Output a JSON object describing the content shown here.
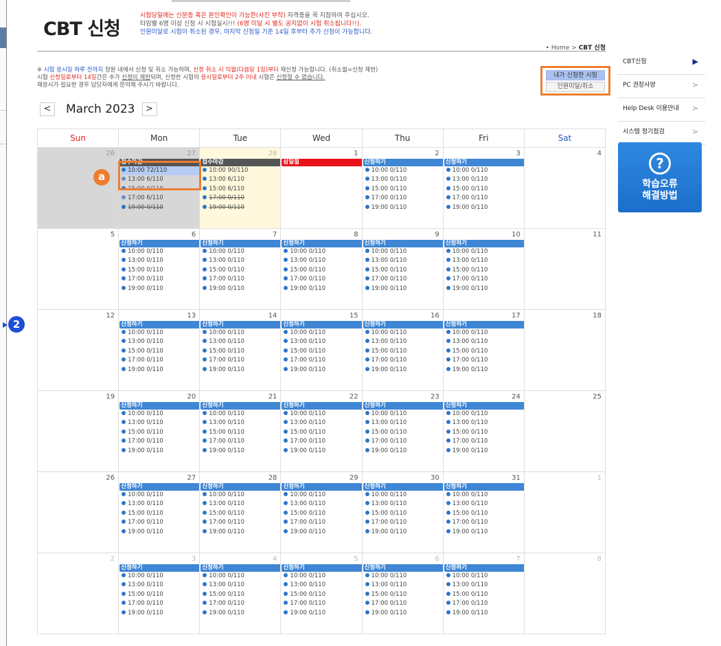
{
  "header": {
    "title": "CBT 신청",
    "notice": [
      {
        "parts": [
          {
            "t": "시험당일",
            "c": "red"
          },
          {
            "t": "에는 신분증 혹은 ",
            "c": "red"
          },
          {
            "t": "본인확인이 가능한(사진 부착)",
            "c": "red"
          },
          {
            "t": " 자격증을 꼭 지참하여 주십시오.",
            "c": "gray"
          }
        ]
      },
      {
        "parts": [
          {
            "t": "타임별 6명 이상 신청 시 시험실시!!! ",
            "c": "gray"
          },
          {
            "t": "(6명 미달 시 별도 공지없이 시험 취소됩니다!!).",
            "c": "red"
          }
        ]
      },
      {
        "parts": [
          {
            "t": "인원미달로 시험이 취소된 경우, 마지막 신청일 기준 14일 후부터 추가 신청이 가능합니다.",
            "c": "blue"
          }
        ]
      }
    ],
    "breadcrumb_home": "Home",
    "breadcrumb_sep": ">",
    "breadcrumb_current": "CBT 신청"
  },
  "info": {
    "line1": [
      {
        "t": "※ ",
        "c": ""
      },
      {
        "t": "시험 응시일 하루 전까지",
        "c": "blue"
      },
      {
        "t": " 정원 내에서 신청 및 취소 가능하며, ",
        "c": ""
      },
      {
        "t": "신청 취소 시 익월(다음달 1일)부터",
        "c": "red"
      },
      {
        "t": " 재신청 가능합니다. (취소월=신청 제한)",
        "c": ""
      }
    ],
    "line2": [
      {
        "t": "   시험 ",
        "c": ""
      },
      {
        "t": "신청일로부터 14일",
        "c": "red"
      },
      {
        "t": "간은 추가 ",
        "c": ""
      },
      {
        "t": "신청이 제한",
        "c": "u"
      },
      {
        "t": "되며, 신청한 시험의 ",
        "c": ""
      },
      {
        "t": "응시일로부터 2주 이내",
        "c": "red"
      },
      {
        "t": " 시험은 ",
        "c": ""
      },
      {
        "t": "신청할 수 없습니다.",
        "c": "u"
      }
    ],
    "line3": [
      {
        "t": "   재응시가 필요한 경우 담당자에게 문의해 주시기 바랍니다.",
        "c": ""
      }
    ]
  },
  "mybox": {
    "my_exams": "내가 신청한 시험",
    "cancelled": "인원미달/취소"
  },
  "calendar": {
    "month_label": "March 2023",
    "prev": "<",
    "next": ">",
    "weekdays": [
      "Sun",
      "Mon",
      "Tue",
      "Wed",
      "Thu",
      "Fri",
      "Sat"
    ],
    "weeks": [
      [
        {
          "day": "26",
          "state": "past",
          "other": true
        },
        {
          "day": "27",
          "state": "past",
          "other": true,
          "bar": "접수마감",
          "bartype": "closed",
          "slots": [
            {
              "t": "10:00 72/110",
              "s": "hl"
            },
            {
              "t": "13:00 6/110",
              "s": "gray"
            },
            {
              "t": "15:00 0/110",
              "s": "strike"
            },
            {
              "t": "17:00 6/110",
              "s": "gray"
            },
            {
              "t": "19:00 0/110",
              "s": "strike"
            }
          ]
        },
        {
          "day": "28",
          "state": "today",
          "other": true,
          "bar": "접수마감",
          "bartype": "closed",
          "slots": [
            {
              "t": "10:00 90/110",
              "s": ""
            },
            {
              "t": "13:00 6/110",
              "s": ""
            },
            {
              "t": "15:00 6/110",
              "s": ""
            },
            {
              "t": "17:00 0/110",
              "s": "strike"
            },
            {
              "t": "19:00 0/110",
              "s": "strike"
            }
          ]
        },
        {
          "day": "1",
          "bar": "삼일절",
          "bartype": "holiday"
        },
        {
          "day": "2",
          "bar": "신청하기",
          "bartype": "apply",
          "slots": "std"
        },
        {
          "day": "3",
          "bar": "신청하기",
          "bartype": "apply",
          "slots": "std"
        },
        {
          "day": "4"
        }
      ],
      [
        {
          "day": "5"
        },
        {
          "day": "6",
          "bar": "신청하기",
          "bartype": "apply",
          "slots": "std"
        },
        {
          "day": "7",
          "bar": "신청하기",
          "bartype": "apply",
          "slots": "std"
        },
        {
          "day": "8",
          "bar": "신청하기",
          "bartype": "apply",
          "slots": "std"
        },
        {
          "day": "9",
          "bar": "신청하기",
          "bartype": "apply",
          "slots": "std"
        },
        {
          "day": "10",
          "bar": "신청하기",
          "bartype": "apply",
          "slots": "std"
        },
        {
          "day": "11"
        }
      ],
      [
        {
          "day": "12"
        },
        {
          "day": "13",
          "bar": "신청하기",
          "bartype": "apply",
          "slots": "std"
        },
        {
          "day": "14",
          "bar": "신청하기",
          "bartype": "apply",
          "slots": "std"
        },
        {
          "day": "15",
          "bar": "신청하기",
          "bartype": "apply",
          "slots": "std"
        },
        {
          "day": "16",
          "bar": "신청하기",
          "bartype": "apply",
          "slots": "std"
        },
        {
          "day": "17",
          "bar": "신청하기",
          "bartype": "apply",
          "slots": "std"
        },
        {
          "day": "18"
        }
      ],
      [
        {
          "day": "19"
        },
        {
          "day": "20",
          "bar": "신청하기",
          "bartype": "apply",
          "slots": "std"
        },
        {
          "day": "21",
          "bar": "신청하기",
          "bartype": "apply",
          "slots": "std"
        },
        {
          "day": "22",
          "bar": "신청하기",
          "bartype": "apply",
          "slots": "std"
        },
        {
          "day": "23",
          "bar": "신청하기",
          "bartype": "apply",
          "slots": "std"
        },
        {
          "day": "24",
          "bar": "신청하기",
          "bartype": "apply",
          "slots": "std"
        },
        {
          "day": "25"
        }
      ],
      [
        {
          "day": "26"
        },
        {
          "day": "27",
          "bar": "신청하기",
          "bartype": "apply",
          "slots": "std"
        },
        {
          "day": "28",
          "bar": "신청하기",
          "bartype": "apply",
          "slots": "std"
        },
        {
          "day": "29",
          "bar": "신청하기",
          "bartype": "apply",
          "slots": "std"
        },
        {
          "day": "30",
          "bar": "신청하기",
          "bartype": "apply",
          "slots": "std"
        },
        {
          "day": "31",
          "bar": "신청하기",
          "bartype": "apply",
          "slots": "std"
        },
        {
          "day": "1",
          "other": true
        }
      ],
      [
        {
          "day": "2",
          "other": true
        },
        {
          "day": "3",
          "other": true,
          "bar": "신청하기",
          "bartype": "apply",
          "slots": "std"
        },
        {
          "day": "4",
          "other": true,
          "bar": "신청하기",
          "bartype": "apply",
          "slots": "std"
        },
        {
          "day": "5",
          "other": true,
          "bar": "신청하기",
          "bartype": "apply",
          "slots": "std"
        },
        {
          "day": "6",
          "other": true,
          "bar": "신청하기",
          "bartype": "apply",
          "slots": "std"
        },
        {
          "day": "7",
          "other": true,
          "bar": "신청하기",
          "bartype": "apply",
          "slots": "std"
        },
        {
          "day": "8",
          "other": true
        }
      ]
    ],
    "std_slots": [
      "10:00 0/110",
      "13:00 0/110",
      "15:00 0/110",
      "17:00 0/110",
      "19:00 0/110"
    ]
  },
  "sidebar": {
    "items": [
      {
        "label": "CBT신청",
        "arrow": "▶",
        "active": true
      },
      {
        "label": "PC 권장사양",
        "arrow": ">"
      },
      {
        "label": "Help Desk 이용안내",
        "arrow": ">"
      },
      {
        "label": "시스템 정기점검",
        "arrow": ">"
      }
    ],
    "banner_icon": "?",
    "banner_line1": "학습오류",
    "banner_line2": "해결방법"
  },
  "markers": {
    "a": "a",
    "two": "2"
  },
  "colors": {
    "accent_orange": "#ee7d31",
    "apply_blue": "#3f86d5",
    "holiday_red": "#e8141a",
    "closed_gray": "#555555"
  }
}
